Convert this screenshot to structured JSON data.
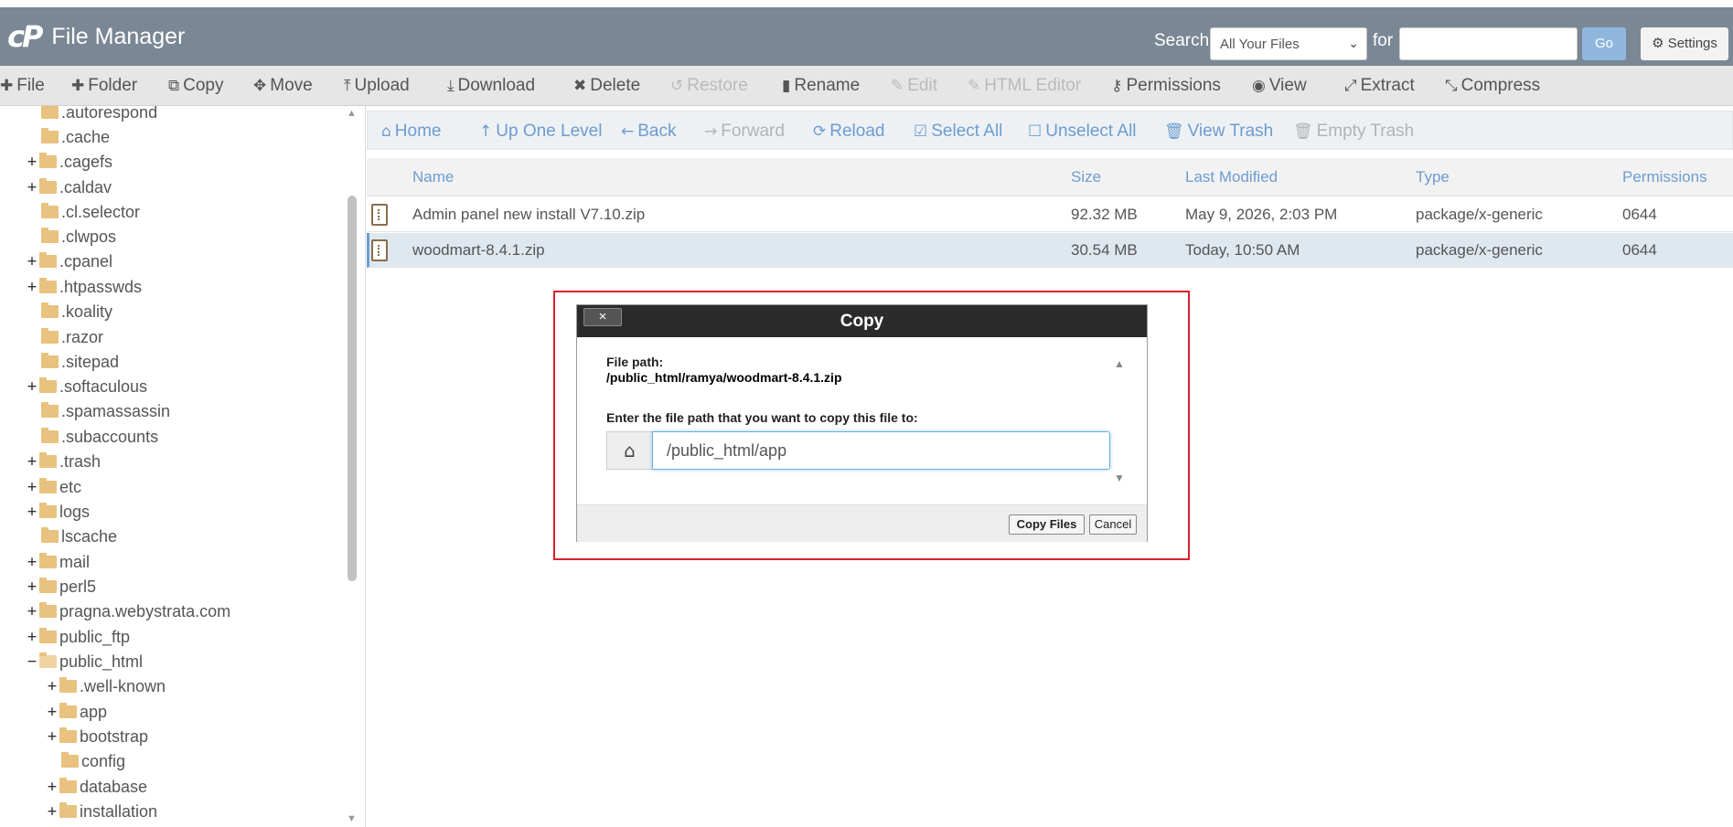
{
  "header": {
    "logo": "cP",
    "title": "File Manager",
    "search_label": "Search",
    "search_scope": "All Your Files",
    "for_label": "for",
    "search_value": "",
    "go_label": "Go",
    "settings_label": "Settings"
  },
  "toolbar": {
    "file": "File",
    "folder": "Folder",
    "copy": "Copy",
    "move": "Move",
    "upload": "Upload",
    "download": "Download",
    "delete": "Delete",
    "restore": "Restore",
    "rename": "Rename",
    "edit": "Edit",
    "html_editor": "HTML Editor",
    "permissions": "Permissions",
    "view": "View",
    "extract": "Extract",
    "compress": "Compress"
  },
  "tree": [
    ".autorespond",
    ".cache",
    ".cagefs",
    ".caldav",
    ".cl.selector",
    ".clwpos",
    ".cpanel",
    ".htpasswds",
    ".koality",
    ".razor",
    ".sitepad",
    ".softaculous",
    ".spamassassin",
    ".subaccounts",
    ".trash",
    "etc",
    "logs",
    "lscache",
    "mail",
    "perl5",
    "pragna.webystrata.com",
    "public_ftp",
    "public_html",
    ".well-known",
    "app",
    "bootstrap",
    "config",
    "database",
    "installation"
  ],
  "nav": {
    "home": "Home",
    "up": "Up One Level",
    "back": "Back",
    "forward": "Forward",
    "reload": "Reload",
    "select_all": "Select All",
    "unselect_all": "Unselect All",
    "view_trash": "View Trash",
    "empty_trash": "Empty Trash"
  },
  "columns": {
    "name": "Name",
    "size": "Size",
    "modified": "Last Modified",
    "type": "Type",
    "perms": "Permissions"
  },
  "files": [
    {
      "name": "Admin panel new install V7.10.zip",
      "size": "92.32 MB",
      "modified": "May 9, 2026, 2:03 PM",
      "type": "package/x-generic",
      "perms": "0644"
    },
    {
      "name": "woodmart-8.4.1.zip",
      "size": "30.54 MB",
      "modified": "Today, 10:50 AM",
      "type": "package/x-generic",
      "perms": "0644"
    }
  ],
  "dialog": {
    "title": "Copy",
    "close": "×",
    "file_path_label": "File path:",
    "file_path": "/public_html/ramya/woodmart-8.4.1.zip",
    "dest_label": "Enter the file path that you want to copy this file to:",
    "dest_value": "/public_html/app",
    "copy_button": "Copy Files",
    "cancel_button": "Cancel"
  }
}
